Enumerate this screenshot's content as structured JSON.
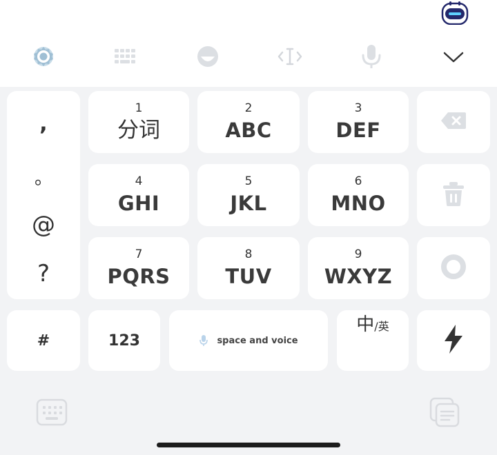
{
  "toolbar": {
    "icons": [
      "settings-icon",
      "keyboard-layout-icon",
      "emoji-icon",
      "cursor-move-icon",
      "microphone-icon",
      "collapse-keyboard-icon"
    ]
  },
  "keys": {
    "row1": [
      {
        "num": "1",
        "label": "分词"
      },
      {
        "num": "2",
        "label": "ABC"
      },
      {
        "num": "3",
        "label": "DEF"
      }
    ],
    "row2": [
      {
        "num": "4",
        "label": "GHI"
      },
      {
        "num": "5",
        "label": "JKL"
      },
      {
        "num": "6",
        "label": "MNO"
      }
    ],
    "row3": [
      {
        "num": "7",
        "label": "PQRS"
      },
      {
        "num": "8",
        "label": "TUV"
      },
      {
        "num": "9",
        "label": "WXYZ"
      }
    ]
  },
  "punctuation": [
    ",",
    "。",
    "@",
    "?"
  ],
  "bottom_row": {
    "symbol_key": "#",
    "number_key": "123",
    "space_key": "space and voice",
    "lang_key_primary": "中",
    "lang_key_secondary": "/英"
  },
  "right_column": [
    "backspace-icon",
    "trash-icon",
    "circle-icon",
    "lightning-icon"
  ],
  "footer_icons": [
    "keyboard-switch-icon",
    "clipboard-icon"
  ],
  "colors": {
    "keyboard_bg": "#f2f3f5",
    "key_bg": "#ffffff",
    "icon_muted": "#d3d6db",
    "accent_blue": "#2f6bd8"
  }
}
